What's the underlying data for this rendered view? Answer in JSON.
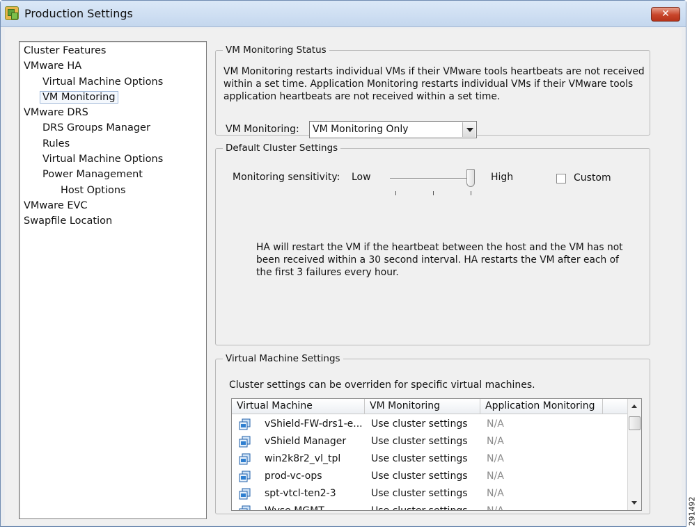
{
  "window": {
    "title": "Production Settings",
    "close_label": "✕"
  },
  "nav": {
    "items": [
      {
        "label": "Cluster Features",
        "level": 0
      },
      {
        "label": "VMware HA",
        "level": 0
      },
      {
        "label": "Virtual Machine Options",
        "level": 1
      },
      {
        "label": "VM Monitoring",
        "level": 1,
        "selected": true
      },
      {
        "label": "VMware DRS",
        "level": 0
      },
      {
        "label": "DRS Groups Manager",
        "level": 1
      },
      {
        "label": "Rules",
        "level": 1
      },
      {
        "label": "Virtual Machine Options",
        "level": 1
      },
      {
        "label": "Power Management",
        "level": 1
      },
      {
        "label": "Host Options",
        "level": 2
      },
      {
        "label": "VMware EVC",
        "level": 0
      },
      {
        "label": "Swapfile Location",
        "level": 0
      }
    ]
  },
  "vm_monitoring_status": {
    "legend": "VM Monitoring Status",
    "description_lines": [
      "VM Monitoring restarts individual VMs if their VMware tools heartbeats are not received",
      "within a set time.  Application Monitoring restarts individual VMs if their VMware tools",
      "application heartbeats are not received within a set time."
    ],
    "monitoring_label": "VM Monitoring:",
    "monitoring_value": "VM Monitoring Only"
  },
  "default_cluster_settings": {
    "legend": "Default Cluster Settings",
    "sensitivity_label": "Monitoring sensitivity:",
    "low_label": "Low",
    "high_label": "High",
    "custom_label": "Custom",
    "custom_checked": false,
    "sensitivity_level": "High",
    "description_lines": [
      "HA will restart the VM if the heartbeat between the host and the VM has not",
      "been received within a 30 second interval. HA restarts the VM after each of",
      "the first 3 failures every hour."
    ]
  },
  "virtual_machine_settings": {
    "legend": "Virtual Machine Settings",
    "note": "Cluster settings can be overriden for specific virtual machines.",
    "columns": [
      "Virtual Machine",
      "VM Monitoring",
      "Application Monitoring"
    ],
    "rows": [
      [
        "vShield-FW-drs1-e...",
        "Use cluster settings",
        "N/A"
      ],
      [
        "vShield Manager",
        "Use cluster settings",
        "N/A"
      ],
      [
        "win2k8r2_vl_tpl",
        "Use cluster settings",
        "N/A"
      ],
      [
        "prod-vc-ops",
        "Use cluster settings",
        "N/A"
      ],
      [
        "spt-vtcl-ten2-3",
        "Use cluster settings",
        "N/A"
      ],
      [
        "Wyse MGMT",
        "Use cluster settings",
        "N/A"
      ]
    ]
  },
  "figure_id": "291492"
}
